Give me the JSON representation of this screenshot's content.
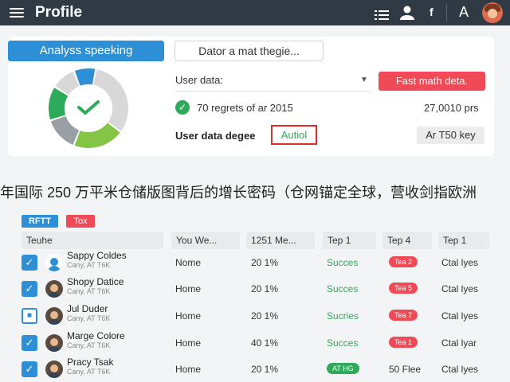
{
  "topbar": {
    "title": "Profile",
    "icons": [
      "menu-icon",
      "list-icon",
      "user-icon",
      "info-icon",
      "text-icon",
      "avatar"
    ],
    "text_icon_label": "A",
    "info_label": "f"
  },
  "summary": {
    "analysis_button": "Analyss speeking",
    "outline_button": "Dator a mat thegie...",
    "select_label": "User data:",
    "red_button": "Fast math deta.",
    "check_text": "70 regrets of ar 2015",
    "check_right": "27,0010 prs",
    "user_data_label": "User data degee",
    "user_data_value": "Autiol",
    "key_label": "Ar T50 key",
    "donut_segments": [
      {
        "color": "#2d8fd6",
        "fraction": 0.09
      },
      {
        "color": "#d8d8d8",
        "fraction": 0.32
      },
      {
        "color": "#85c546",
        "fraction": 0.21
      },
      {
        "color": "#9a9fa5",
        "fraction": 0.14
      },
      {
        "color": "#2eaa5b",
        "fraction": 0.14
      },
      {
        "color": "#d8d8d8",
        "fraction": 0.1
      }
    ]
  },
  "banner": "年国际 250 万平米仓储版图背后的增长密码（仓网锚定全球，营收剑指欧洲",
  "tags": {
    "rftt": "RFTT",
    "tox": "Tox"
  },
  "table": {
    "headers": [
      "Teuhe",
      "You We...",
      "1251 Me...",
      "Tep 1",
      "Tep 4",
      "Tep 1"
    ],
    "rows": [
      {
        "name": "Sappy Coldes",
        "sub": "Cany, AT T6K",
        "c2": "Nome",
        "c3": "20 1%",
        "status": "Succes",
        "pill": "Tea 2",
        "pill_color": "red",
        "last": "Ctal lyes",
        "checkbox": "checked",
        "avatar": "blue"
      },
      {
        "name": "Shopy Datice",
        "sub": "Cany, AT T6K",
        "c2": "Home",
        "c3": "20 1%",
        "status": "Succes",
        "pill": "Tea 5",
        "pill_color": "red",
        "last": "Ctal lyes",
        "checkbox": "checked",
        "avatar": "photo"
      },
      {
        "name": "Jul Duder",
        "sub": "Cany, AT T6K",
        "c2": "Home",
        "c3": "20 1%",
        "status": "Sucries",
        "pill": "Tea 7",
        "pill_color": "red",
        "last": "Ctal lyes",
        "checkbox": "square",
        "avatar": "photo"
      },
      {
        "name": "Marge Colore",
        "sub": "Cany, AT T6K",
        "c2": "Home",
        "c3": "40 1%",
        "status": "Succes",
        "pill": "Tea 1",
        "pill_color": "red",
        "last": "Ctal lyar",
        "checkbox": "checked",
        "avatar": "photo"
      },
      {
        "name": "Pracy Tsak",
        "sub": "Cany, AT T6K",
        "c2": "Home",
        "c3": "20 1%",
        "status": "",
        "pill": "AT HG",
        "pill_color": "green",
        "last": "Ctal lyes",
        "extra": "50 Flee",
        "checkbox": "checked",
        "avatar": "photo"
      }
    ]
  }
}
